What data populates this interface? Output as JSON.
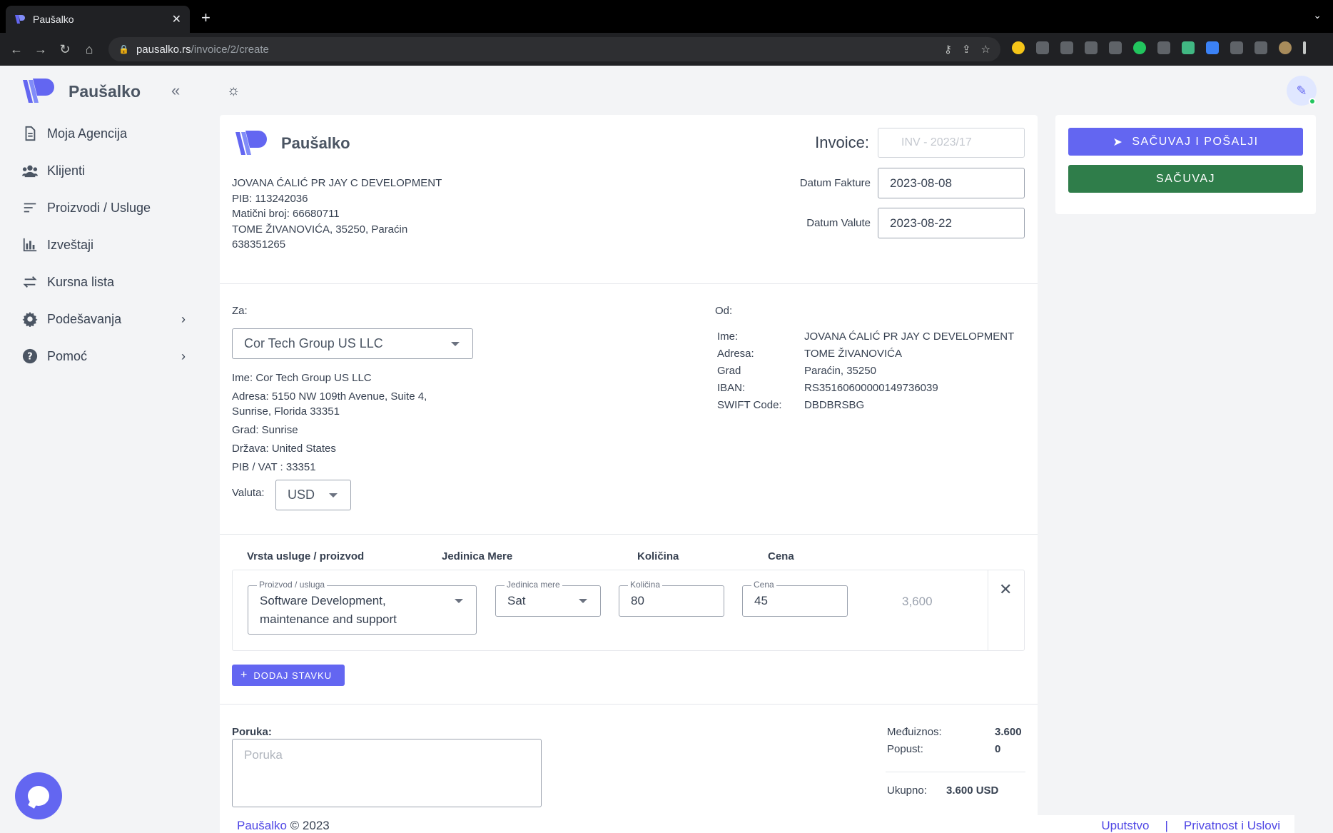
{
  "browser": {
    "tab_title": "Paušalko",
    "url_host": "pausalko.rs",
    "url_path": "/invoice/2/create",
    "new_tab": "+",
    "close_tab": "✕"
  },
  "sidebar": {
    "brand": "Paušalko",
    "items": [
      {
        "label": "Moja Agencija",
        "icon": "document-icon"
      },
      {
        "label": "Klijenti",
        "icon": "users-icon"
      },
      {
        "label": "Proizvodi / Usluge",
        "icon": "list-icon"
      },
      {
        "label": "Izveštaji",
        "icon": "bar-chart-icon"
      },
      {
        "label": "Kursna lista",
        "icon": "exchange-icon"
      },
      {
        "label": "Podešavanja",
        "icon": "gear-icon"
      },
      {
        "label": "Pomoć",
        "icon": "help-icon"
      }
    ]
  },
  "invoice": {
    "brand": "Paušalko",
    "issuer_lines": [
      "JOVANA ĆALIĆ PR JAY C DEVELOPMENT",
      "PIB: 113242036",
      "Matični broj: 66680711",
      "TOME ŽIVANOVIĆA, 35250, Paraćin",
      "638351265"
    ],
    "invoice_label": "Invoice:",
    "invoice_placeholder": "INV - 2023/17",
    "date_label": "Datum Fakture",
    "date_value": "2023-08-08",
    "due_label": "Datum Valute",
    "due_value": "2023-08-22"
  },
  "client": {
    "za_label": "Za:",
    "selected": "Cor Tech Group US LLC",
    "ime": "Ime: Cor Tech Group US LLC",
    "adresa1": "Adresa: 5150 NW 109th Avenue, Suite 4,",
    "adresa2": "Sunrise, Florida 33351",
    "grad": "Grad: Sunrise",
    "drzava": "Država: United States",
    "pib": "PIB / VAT : 33351",
    "valuta_label": "Valuta:",
    "valuta": "USD"
  },
  "from": {
    "od_label": "Od:",
    "rows": [
      {
        "k": "Ime:",
        "v": "JOVANA ĆALIĆ PR JAY C DEVELOPMENT"
      },
      {
        "k": "Adresa:",
        "v": "TOME ŽIVANOVIĆA"
      },
      {
        "k": "Grad",
        "v": "Paraćin, 35250"
      },
      {
        "k": "IBAN:",
        "v": "RS35160600000149736039"
      },
      {
        "k": "SWIFT Code:",
        "v": "DBDBRSBG"
      }
    ]
  },
  "items_table": {
    "headers": [
      "Vrsta usluge / proizvod",
      "Jedinica Mere",
      "Količina",
      "Cena"
    ],
    "row": {
      "product_label": "Proizvod / usluga",
      "product_line1": "Software Development,",
      "product_line2": "maintenance and support",
      "unit_label": "Jedinica mere",
      "unit": "Sat",
      "qty_label": "Količina",
      "qty": "80",
      "price_label": "Cena",
      "price": "45",
      "total": "3,600"
    },
    "add_button": "DODAJ STAVKU"
  },
  "message": {
    "label": "Poruka:",
    "placeholder": "Poruka"
  },
  "totals": {
    "subtotal_label": "Međuiznos:",
    "subtotal": "3.600",
    "discount_label": "Popust:",
    "discount": "0",
    "total_label": "Ukupno:",
    "total": "3.600 USD"
  },
  "actions": {
    "send": "SAČUVAJ I POŠALJI",
    "save": "SAČUVAJ"
  },
  "footer": {
    "brand": "Paušalko",
    "copy": " © 2023",
    "link1": "Uputstvo",
    "sep": "|",
    "link2": "Privatnost i Uslovi"
  },
  "colors": {
    "accent": "#6366f1",
    "save": "#2f7d4a"
  }
}
